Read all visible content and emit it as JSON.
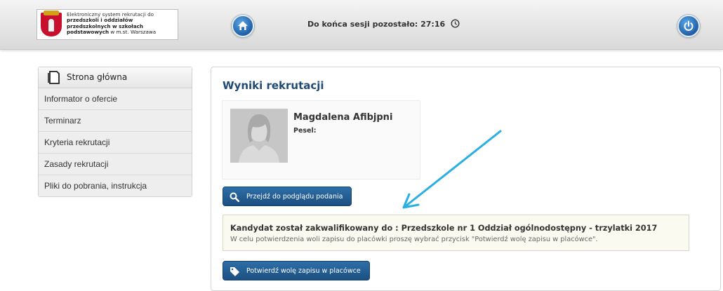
{
  "header": {
    "logo_line1": "Elektroniczny system rekrutacji do",
    "logo_line2": "przedszkoli i oddziałów",
    "logo_line3": "przedszkolnych w szkołach",
    "logo_line4_bold": "podstawowych",
    "logo_line4_rest": " w m.st. Warszawa",
    "session_label": "Do końca sesji pozostało: 27:16",
    "home_icon": "home-icon",
    "power_icon": "power-icon",
    "clock_icon": "clock-icon"
  },
  "sidebar": {
    "header_label": "Strona główna",
    "items": [
      {
        "label": "Informator o ofercie"
      },
      {
        "label": "Terminarz"
      },
      {
        "label": "Kryteria rekrutacji"
      },
      {
        "label": "Zasady rekrutacji"
      },
      {
        "label": "Pliki do pobrania, instrukcja"
      }
    ]
  },
  "main": {
    "title": "Wyniki rekrutacji",
    "candidate_name": "Magdalena Afibjpni",
    "pesel_label": "Pesel:",
    "preview_button": "Przejdź do podglądu podania",
    "result_text": "Kandydat został zakwalifikowany do : Przedszkole nr 1 Oddział ogólnodostępny - trzylatki 2017",
    "result_hint": "W celu potwierdzenia woli zapisu do placówki proszę wybrać przycisk \"Potwierdź wolę zapisu w placówce\".",
    "confirm_button": "Potwierdź wolę zapisu w placówce"
  },
  "colors": {
    "accent": "#1f4a75",
    "button": "#245e94",
    "arrow": "#29aee6"
  }
}
